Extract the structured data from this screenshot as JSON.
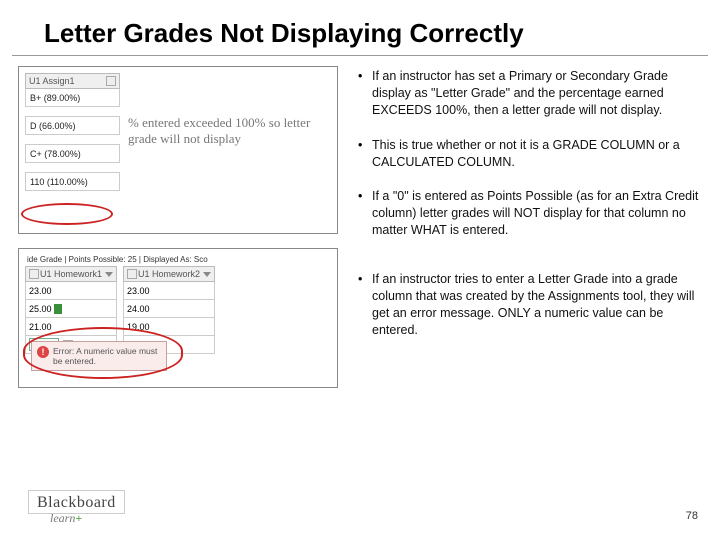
{
  "title": "Letter Grades Not Displaying Correctly",
  "page_number": "78",
  "logo": {
    "brand": "Blackboard",
    "sub": "learn",
    "plus": "+"
  },
  "bullets": [
    "If an instructor has set a Primary or Secondary Grade display as \"Letter Grade\" and the percentage earned EXCEEDS 100%, then a letter grade will not display.",
    "This is true whether or not it is a GRADE COLUMN or a CALCULATED COLUMN.",
    "If a \"0\" is entered as Points Possible (as for an Extra Credit column) letter grades will NOT display for that column no matter WHAT is entered.",
    "If an instructor tries to enter a Letter Grade into a grade column that was created by the Assignments tool, they will get an error message. ONLY a numeric value can be entered."
  ],
  "frame1": {
    "column_header": "U1 Assign1",
    "rows": [
      "B+ (89.00%)",
      "D (66.00%)",
      "C+ (78.00%)",
      "110 (110.00%)"
    ],
    "annotation": "% entered exceeded 100% so letter grade will not display"
  },
  "frame2": {
    "topline": "ide Grade | Points Possible: 25 | Displayed As: Sco",
    "cols": [
      {
        "hdr": "U1 Homework1",
        "cells": [
          "23.00",
          "25.00",
          "21.00",
          "B"
        ]
      },
      {
        "hdr": "U1 Homework2",
        "cells": [
          "23.00",
          "24.00",
          "19.00",
          "--"
        ]
      }
    ],
    "error": "Error: A numeric value must be entered."
  }
}
